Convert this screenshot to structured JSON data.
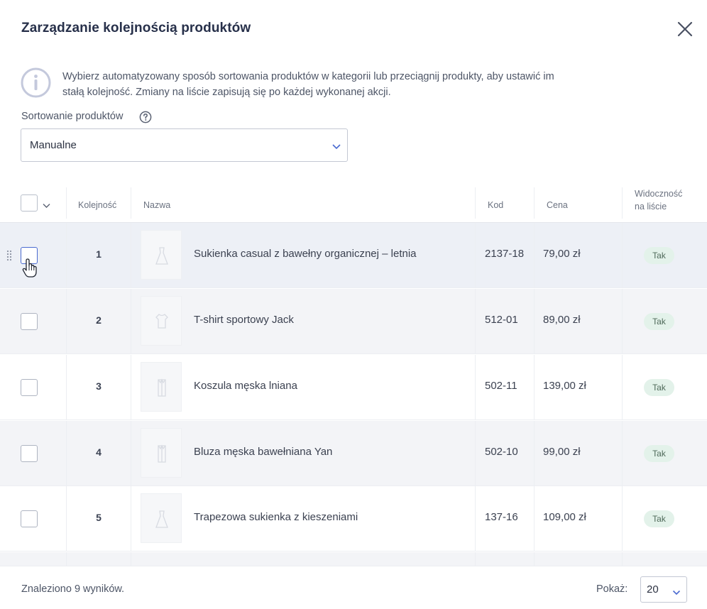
{
  "dialog": {
    "title": "Zarządzanie kolejnością produktów",
    "info_text": "Wybierz automatyzowany sposób sortowania produktów w kategorii lub przeciągnij produkty, aby ustawić im stałą kolejność. Zmiany na liście zapisują się po każdej wykonanej akcji."
  },
  "sorting": {
    "label": "Sortowanie produktów",
    "selected": "Manualne"
  },
  "table": {
    "columns": {
      "order": "Kolejność",
      "name": "Nazwa",
      "code": "Kod",
      "price": "Cena",
      "visibility_line1": "Widoczność",
      "visibility_line2": "na liście"
    },
    "rows": [
      {
        "order": "1",
        "name": "Sukienka casual z bawełny organicznej – letnia",
        "code": "2137-18",
        "price": "79,00 zł",
        "visible": "Tak",
        "thumb_icon": "dress-icon"
      },
      {
        "order": "2",
        "name": "T-shirt sportowy Jack",
        "code": "512-01",
        "price": "89,00 zł",
        "visible": "Tak",
        "thumb_icon": "tshirt-icon"
      },
      {
        "order": "3",
        "name": "Koszula męska lniana",
        "code": "502-11",
        "price": "139,00 zł",
        "visible": "Tak",
        "thumb_icon": "shirt-icon"
      },
      {
        "order": "4",
        "name": "Bluza męska bawełniana Yan",
        "code": "502-10",
        "price": "99,00 zł",
        "visible": "Tak",
        "thumb_icon": "shirt-icon"
      },
      {
        "order": "5",
        "name": "Trapezowa sukienka z kieszeniami",
        "code": "137-16",
        "price": "109,00 zł",
        "visible": "Tak",
        "thumb_icon": "dress-icon"
      }
    ]
  },
  "footer": {
    "found": "Znaleziono 9 wyników.",
    "show_label": "Pokaż:",
    "per_page": "20"
  },
  "colors": {
    "accent": "#4a6ad0",
    "badge_bg": "#e3f2ea",
    "row_alt": "#f3f4f7"
  }
}
